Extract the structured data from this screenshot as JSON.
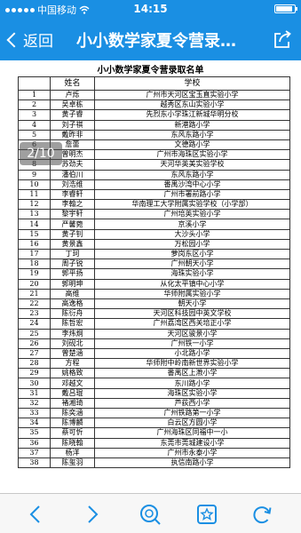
{
  "status": {
    "carrier": "中国移动",
    "time": "14:15"
  },
  "nav": {
    "back_label": "返回",
    "title": "小小数学家夏令营录…"
  },
  "doc": {
    "title": "小小数学家夏令营录取名单",
    "headers": [
      "",
      "姓名",
      "学校"
    ],
    "rows": [
      [
        "1",
        "卢烁",
        "广州市天河区宝玉直实验小学"
      ],
      [
        "2",
        "吴卓栋",
        "越秀区东山实验小学"
      ],
      [
        "3",
        "黄子睿",
        "先烈东小学珠江新城华明分校"
      ],
      [
        "4",
        "刘子祺",
        "新港路小学"
      ],
      [
        "5",
        "戴昨非",
        "东风东路小学"
      ],
      [
        "6",
        "詹蕾",
        "文德路小学"
      ],
      [
        "7",
        "曾明杰",
        "广州市海珠区实验小学"
      ],
      [
        "8",
        "苏劲夫",
        "天河华英美实验学校"
      ],
      [
        "9",
        "潘伯川",
        "东风东路小学"
      ],
      [
        "10",
        "刘浩维",
        "番禺沙湾中心小学"
      ],
      [
        "11",
        "李睿轩",
        "广州市署前路小学"
      ],
      [
        "12",
        "李翰之",
        "华南理工大学附属实验学校（小学部）"
      ],
      [
        "13",
        "黎宇轩",
        "广州培英实验小学"
      ],
      [
        "14",
        "严馨菀",
        "京溪小学"
      ],
      [
        "15",
        "黄子钊",
        "大沙头小学"
      ],
      [
        "16",
        "黄景鑫",
        "万松园小学"
      ],
      [
        "17",
        "丁珂",
        "萝岗东区小学"
      ],
      [
        "18",
        "周子锐",
        "广州朝天小学"
      ],
      [
        "19",
        "郭平扬",
        "海珠实验小学"
      ],
      [
        "20",
        "郭明坤",
        "从化太平镇中心小学"
      ],
      [
        "21",
        "高维",
        "华师附属实验小学"
      ],
      [
        "22",
        "高逸格",
        "朝天小学"
      ],
      [
        "23",
        "陈衍舟",
        "天河区科技园中英文学校"
      ],
      [
        "24",
        "陈哲宏",
        "广州荔湾区西关培正小学"
      ],
      [
        "25",
        "李炜炯",
        "天河区骏景小学"
      ],
      [
        "26",
        "刘砚北",
        "广州铁一小学"
      ],
      [
        "27",
        "曾楚涵",
        "小北路小学"
      ],
      [
        "28",
        "方程",
        "华师附中岭南新世界实验小学"
      ],
      [
        "29",
        "姚格致",
        "番禺区上漖小学"
      ],
      [
        "30",
        "邓越文",
        "东川路小学"
      ],
      [
        "31",
        "戴吕琨",
        "海珠区实验小学"
      ],
      [
        "32",
        "褚湘琦",
        "芦荻西小学"
      ],
      [
        "33",
        "陈奕涵",
        "广州铁路第一小学"
      ],
      [
        "34",
        "陈博麟",
        "白云区方圆小学"
      ],
      [
        "35",
        "蔡可忻",
        "广州海珠区同福中一小"
      ],
      [
        "36",
        "陈晓翰",
        "东莞市莞城建设小学"
      ],
      [
        "37",
        "杨洋",
        "广州市永泰小学"
      ],
      [
        "38",
        "陈玺羽",
        "执信南路小学"
      ]
    ]
  },
  "page_indicator": "2/10",
  "toolbar": {
    "icons": [
      "back-arrow-icon",
      "forward-arrow-icon",
      "search-icon",
      "bookmark-star-icon",
      "refresh-icon"
    ]
  }
}
